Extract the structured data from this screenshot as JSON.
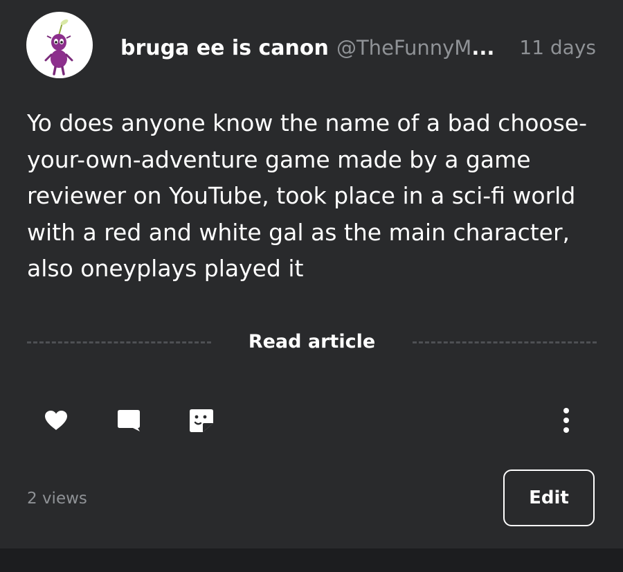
{
  "post": {
    "author": {
      "avatar": "purple-pikmin-avatar",
      "name": "bruga ee is canon",
      "handle": "@TheFunnyM",
      "handle_truncation": "..."
    },
    "timestamp": "11 days",
    "body": "Yo does anyone know the name of a bad choose-your-own-adventure game made by a game reviewer on YouTube, took place in a sci-fi world with a red and white gal as the main character, also oneyplays played it",
    "read_article_label": "Read article",
    "actions": [
      {
        "name": "like",
        "icon": "heart-icon"
      },
      {
        "name": "comment",
        "icon": "comment-bubble-icon"
      },
      {
        "name": "react",
        "icon": "sticker-face-icon"
      },
      {
        "name": "more",
        "icon": "more-vertical-icon"
      }
    ],
    "views": "2 views",
    "edit_label": "Edit"
  },
  "colors": {
    "card_background": "#292a2c",
    "page_background": "#1c1d1f",
    "text_primary": "#ffffff",
    "text_secondary": "#8f9296",
    "avatar_purple": "#8c2f8c"
  }
}
